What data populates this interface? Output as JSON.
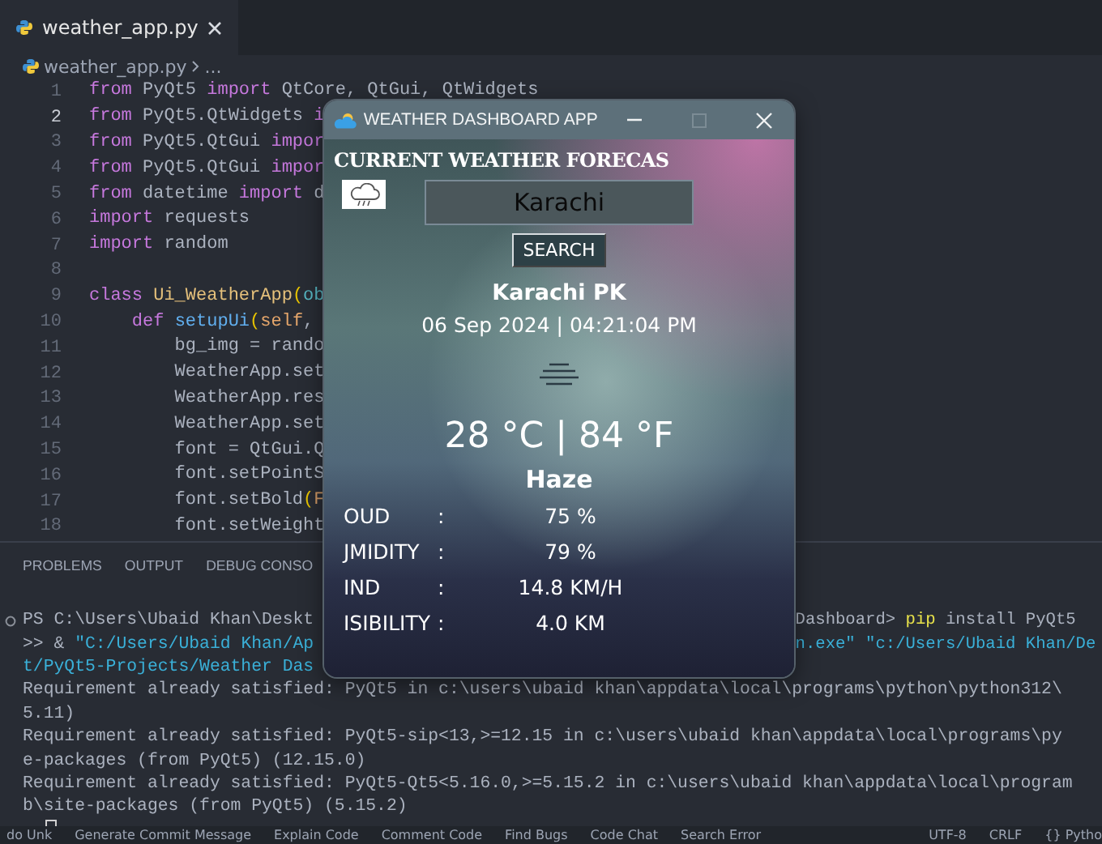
{
  "editor_tab": {
    "label": "weather_app.py",
    "selected": true
  },
  "breadcrumb": {
    "file": "weather_app.py",
    "more": "..."
  },
  "code_lines": [
    {
      "n": "1",
      "current": false,
      "tokens": [
        {
          "kind": "kw",
          "text": "from"
        },
        {
          "kind": "plain",
          "text": " PyQt5 "
        },
        {
          "kind": "kw",
          "text": "import"
        },
        {
          "kind": "plain",
          "text": " QtCore, QtGui, QtWidgets"
        }
      ]
    },
    {
      "n": "2",
      "current": true,
      "tokens": [
        {
          "kind": "kw",
          "text": "from"
        },
        {
          "kind": "plain",
          "text": " PyQt5.QtWidgets "
        },
        {
          "kind": "kw",
          "text": "i"
        }
      ]
    },
    {
      "n": "3",
      "current": false,
      "tokens": [
        {
          "kind": "kw",
          "text": "from"
        },
        {
          "kind": "plain",
          "text": " PyQt5.QtGui "
        },
        {
          "kind": "kw",
          "text": "impor"
        }
      ]
    },
    {
      "n": "4",
      "current": false,
      "tokens": [
        {
          "kind": "kw",
          "text": "from"
        },
        {
          "kind": "plain",
          "text": " PyQt5.QtGui "
        },
        {
          "kind": "kw",
          "text": "impor"
        }
      ]
    },
    {
      "n": "5",
      "current": false,
      "tokens": [
        {
          "kind": "kw",
          "text": "from"
        },
        {
          "kind": "plain",
          "text": " datetime "
        },
        {
          "kind": "kw",
          "text": "import"
        },
        {
          "kind": "plain",
          "text": " d"
        }
      ]
    },
    {
      "n": "6",
      "current": false,
      "tokens": [
        {
          "kind": "kw",
          "text": "import"
        },
        {
          "kind": "plain",
          "text": " requests"
        }
      ]
    },
    {
      "n": "7",
      "current": false,
      "tokens": [
        {
          "kind": "kw",
          "text": "import"
        },
        {
          "kind": "plain",
          "text": " random"
        }
      ]
    },
    {
      "n": "8",
      "current": false
    },
    {
      "n": "9",
      "current": false,
      "tokens": [
        {
          "kind": "kw",
          "text": "class "
        },
        {
          "kind": "cls",
          "text": "Ui_WeatherApp"
        },
        {
          "kind": "paren",
          "text": "("
        },
        {
          "kind": "base",
          "text": "ob"
        }
      ]
    },
    {
      "n": "10",
      "current": false,
      "tokens": [
        {
          "kind": "kw",
          "text": "    def "
        },
        {
          "kind": "fn",
          "text": "setupUi"
        },
        {
          "kind": "paren",
          "text": "("
        },
        {
          "kind": "param",
          "text": "self"
        },
        {
          "kind": "plain",
          "text": ","
        }
      ]
    },
    {
      "n": "11",
      "current": false,
      "tokens": [
        {
          "kind": "plain",
          "text": "        bg_img = rando"
        }
      ]
    },
    {
      "n": "12",
      "current": false,
      "tokens": [
        {
          "kind": "plain",
          "text": "        WeatherApp.set"
        }
      ]
    },
    {
      "n": "13",
      "current": false,
      "tokens": [
        {
          "kind": "plain",
          "text": "        WeatherApp.res"
        }
      ]
    },
    {
      "n": "14",
      "current": false,
      "tokens": [
        {
          "kind": "plain",
          "text": "        WeatherApp.set"
        }
      ]
    },
    {
      "n": "15",
      "current": false,
      "tokens": [
        {
          "kind": "plain",
          "text": "        font = QtGui.Q"
        }
      ]
    },
    {
      "n": "16",
      "current": false,
      "tokens": [
        {
          "kind": "plain",
          "text": "        font.setPointS"
        }
      ]
    },
    {
      "n": "17",
      "current": false,
      "tokens": [
        {
          "kind": "plain",
          "text": "        font.setBold"
        },
        {
          "kind": "paren",
          "text": "("
        },
        {
          "kind": "const",
          "text": "F"
        }
      ]
    },
    {
      "n": "18",
      "current": false,
      "tokens": [
        {
          "kind": "plain",
          "text": "        font.setWeight"
        }
      ]
    }
  ],
  "panel_tabs": [
    {
      "label": "PROBLEMS",
      "selected": false
    },
    {
      "label": "OUTPUT",
      "selected": false
    },
    {
      "label": "DEBUG CONSO",
      "selected": false
    }
  ],
  "terminal_lines": [
    {
      "left": [
        {
          "kind": "plain",
          "text": "PS C:\\Users\\Ubaid Khan\\Deskt"
        }
      ],
      "right": [
        {
          "kind": "plain",
          "text": "Dashboard> "
        },
        {
          "kind": "cmd",
          "text": "pip"
        },
        {
          "kind": "plain",
          "text": " install PyQt5"
        }
      ]
    },
    {
      "left": [
        {
          "kind": "plain",
          "text": ">> & "
        },
        {
          "kind": "str",
          "text": "\"C:/Users/Ubaid Khan/Ap"
        }
      ],
      "right": [
        {
          "kind": "str",
          "text": "n.exe\" \"c:/Users/Ubaid Khan/De"
        }
      ]
    },
    {
      "left": [
        {
          "kind": "str",
          "text": "t/PyQt5-Projects/Weather Das"
        }
      ]
    },
    {
      "left": [
        {
          "kind": "plain",
          "text": "Requirement already satisfied: PyQt5 in c:\\users\\ubaid khan\\appdata\\local\\programs\\python\\python312\\"
        }
      ]
    },
    {
      "left": [
        {
          "kind": "plain",
          "text": "5.11)"
        }
      ]
    },
    {
      "left": [
        {
          "kind": "plain",
          "text": "Requirement already satisfied: PyQt5-sip<13,>=12.15 in c:\\users\\ubaid khan\\appdata\\local\\programs\\py"
        }
      ]
    },
    {
      "left": [
        {
          "kind": "plain",
          "text": "e-packages (from PyQt5) (12.15.0)"
        }
      ]
    },
    {
      "left": [
        {
          "kind": "plain",
          "text": "Requirement already satisfied: PyQt5-Qt5<5.16.0,>=5.15.2 in c:\\users\\ubaid khan\\appdata\\local\\program"
        }
      ]
    },
    {
      "left": [
        {
          "kind": "plain",
          "text": "b\\site-packages (from PyQt5) (5.15.2)"
        }
      ]
    }
  ],
  "status_bar": [
    "do Unk",
    "Generate Commit Message",
    "Explain Code",
    "Comment Code",
    "Find Bugs",
    "Code Chat",
    "Search Error",
    "UTF-8",
    "CRLF",
    "{} Pytho"
  ],
  "app_window": {
    "title": "WEATHER DASHBOARD APP",
    "controls": [
      {
        "kind": "minimize",
        "disabled": false
      },
      {
        "kind": "maximize",
        "disabled": true
      },
      {
        "kind": "close",
        "disabled": false
      }
    ],
    "heading": "CURRENT WEATHER FORECAS",
    "search": {
      "value": "Karachi"
    },
    "search_button": "SEARCH",
    "city": "Karachi PK",
    "datetime": "06 Sep 2024 | 04:21:04 PM",
    "temperature": "28 °C | 84 °F",
    "condition": "Haze",
    "details": [
      {
        "label": "OUD",
        "colon": ":",
        "value": "75 %"
      },
      {
        "label": "JMIDITY",
        "colon": ":",
        "value": "79 %"
      },
      {
        "label": "IND",
        "colon": ":",
        "value": "14.8 KM/H"
      },
      {
        "label": "ISIBILITY",
        "colon": ":",
        "value": "4.0 KM"
      }
    ]
  }
}
